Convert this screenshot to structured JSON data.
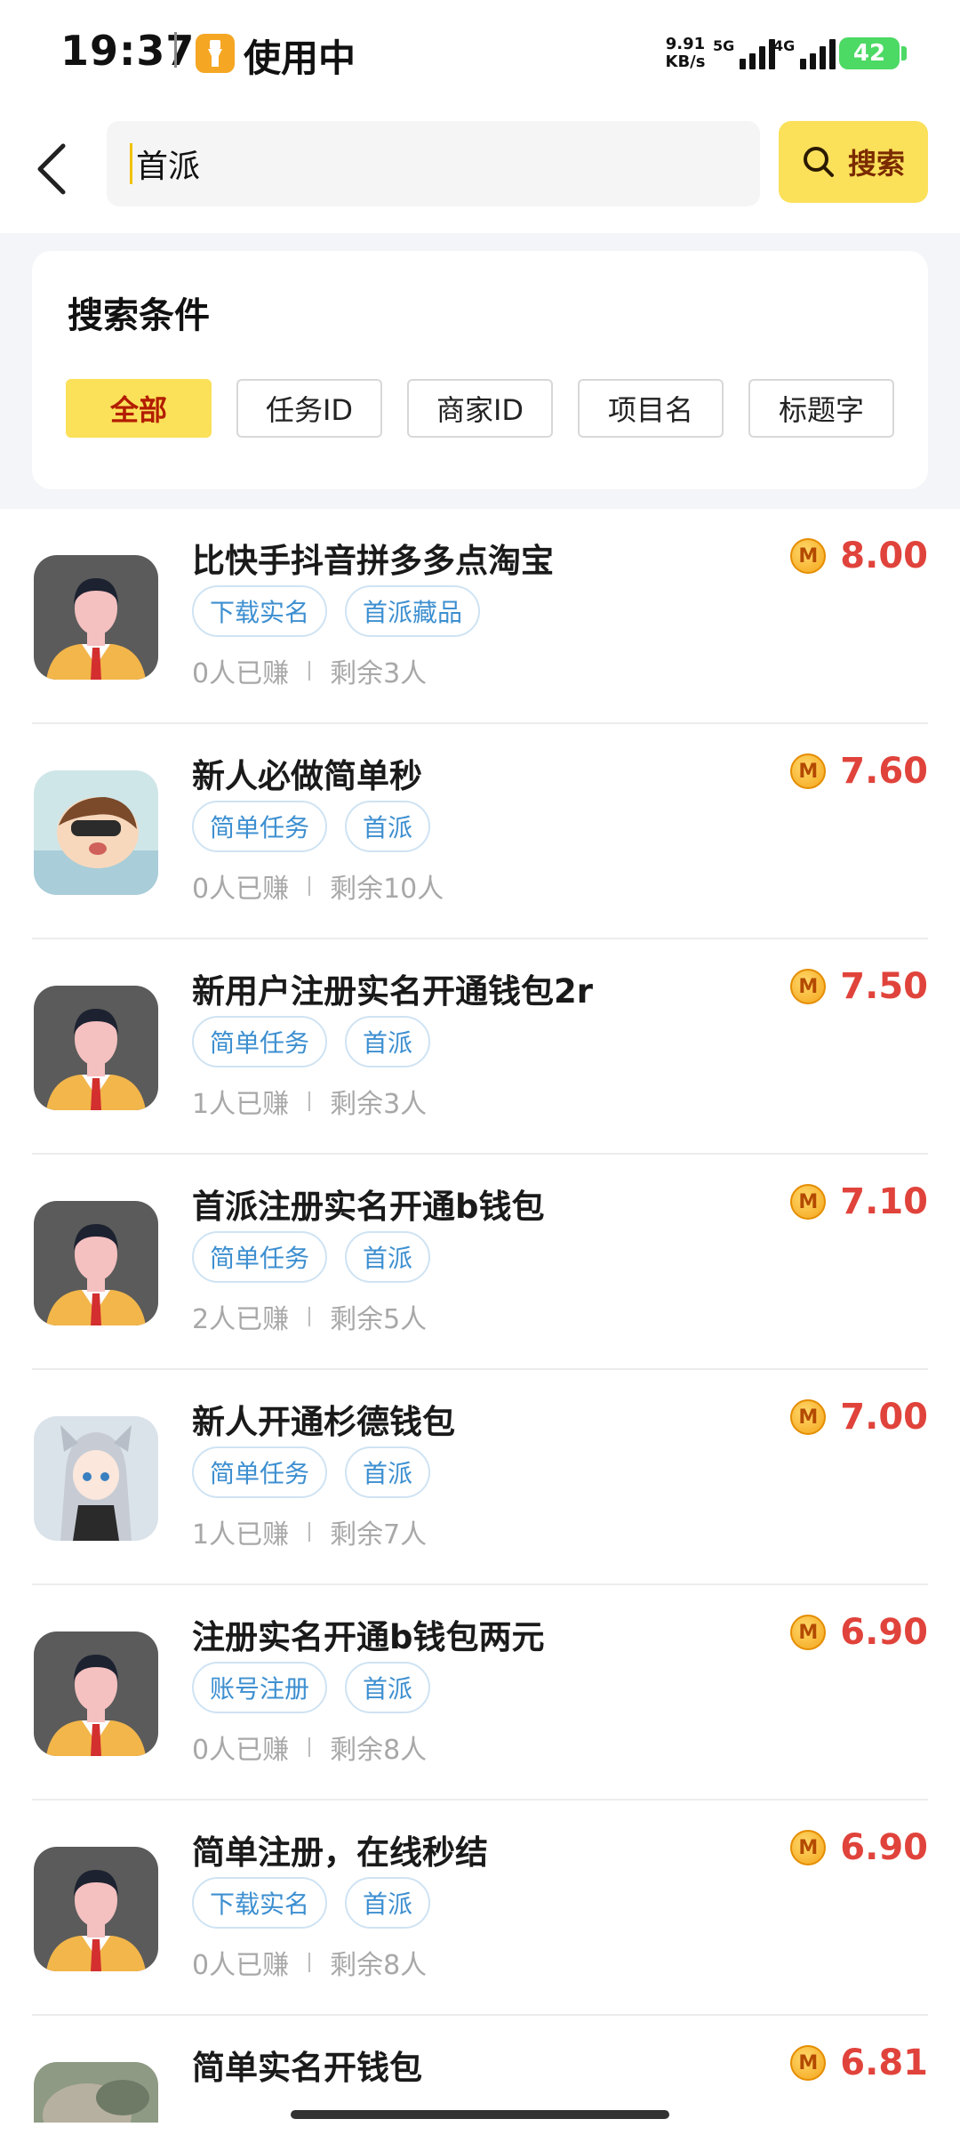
{
  "status": {
    "time": "19:37",
    "app_label": "使用中",
    "net_speed_top": "9.91",
    "net_speed_bottom": "KB/s",
    "sig1": "5G",
    "sig2": "4G",
    "battery": "42"
  },
  "search": {
    "query": "首派",
    "button_label": "搜索"
  },
  "filter": {
    "title": "搜索条件",
    "chips": [
      "全部",
      "任务ID",
      "商家ID",
      "项目名",
      "标题字"
    ],
    "active_index": 0
  },
  "tasks": [
    {
      "title": "比快手抖音拼多多点淘宝",
      "tags": [
        "下载实名",
        "首派藏品"
      ],
      "earned": "0人已赚",
      "remaining": "剩余3人",
      "price": "8.00",
      "avatar": "person"
    },
    {
      "title": "新人必做简单秒",
      "tags": [
        "简单任务",
        "首派"
      ],
      "earned": "0人已赚",
      "remaining": "剩余10人",
      "price": "7.60",
      "avatar": "cartoon"
    },
    {
      "title": "新用户注册实名开通钱包2r",
      "tags": [
        "简单任务",
        "首派"
      ],
      "earned": "1人已赚",
      "remaining": "剩余3人",
      "price": "7.50",
      "avatar": "person"
    },
    {
      "title": "首派注册实名开通b钱包",
      "tags": [
        "简单任务",
        "首派"
      ],
      "earned": "2人已赚",
      "remaining": "剩余5人",
      "price": "7.10",
      "avatar": "person"
    },
    {
      "title": "新人开通杉德钱包",
      "tags": [
        "简单任务",
        "首派"
      ],
      "earned": "1人已赚",
      "remaining": "剩余7人",
      "price": "7.00",
      "avatar": "anime"
    },
    {
      "title": "注册实名开通b钱包两元",
      "tags": [
        "账号注册",
        "首派"
      ],
      "earned": "0人已赚",
      "remaining": "剩余8人",
      "price": "6.90",
      "avatar": "person"
    },
    {
      "title": "简单注册，在线秒结",
      "tags": [
        "下载实名",
        "首派"
      ],
      "earned": "0人已赚",
      "remaining": "剩余8人",
      "price": "6.90",
      "avatar": "person"
    },
    {
      "title": "简单实名开钱包",
      "tags": [],
      "earned": "",
      "remaining": "",
      "price": "6.81",
      "avatar": "photo"
    }
  ],
  "colors": {
    "accent_yellow": "#fbe05a",
    "price_red": "#e0433b",
    "tag_blue": "#3d8fd0"
  }
}
